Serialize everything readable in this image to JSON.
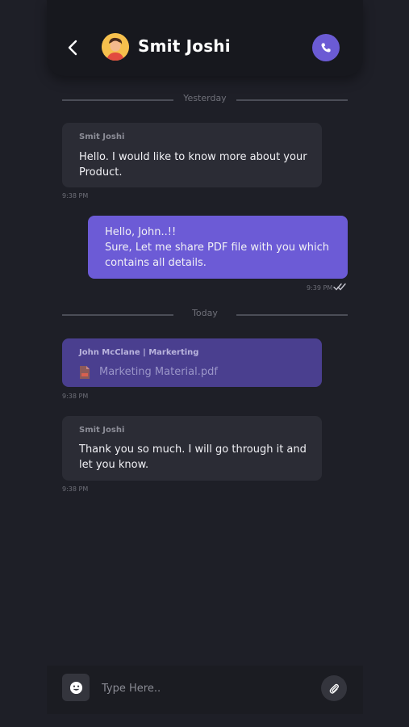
{
  "header": {
    "contact_name": "Smit Joshi"
  },
  "icons": {
    "back": "chevron-left-icon",
    "call": "phone-icon",
    "emoji": "smiley-icon",
    "attach": "paperclip-icon",
    "pdf": "pdf-file-icon",
    "read": "double-check-icon"
  },
  "colors": {
    "accent": "#6c5bd6",
    "background": "#1e1f27",
    "incoming_bubble": "#2b2c35",
    "file_bubble": "#4a3f8f"
  },
  "dividers": {
    "yesterday": "Yesterday",
    "today": "Today"
  },
  "messages": [
    {
      "sender": "Smit Joshi",
      "lines": [
        "Hello. I would like to know more about your",
        "Product."
      ],
      "time": "9:38 PM"
    },
    {
      "lines": [
        "Hello, John..!!",
        "Sure, Let me share PDF file with you which",
        "contains all details."
      ],
      "time": "9:39 PM"
    },
    {
      "sender": "John McClane | Markerting",
      "file_name": "Marketing Material.pdf",
      "time": "9:38 PM"
    },
    {
      "sender": "Smit Joshi",
      "lines": [
        "Thank you so much. I will go through it and",
        "let you know."
      ],
      "time": "9:38 PM"
    }
  ],
  "composer": {
    "placeholder": "Type Here.."
  }
}
